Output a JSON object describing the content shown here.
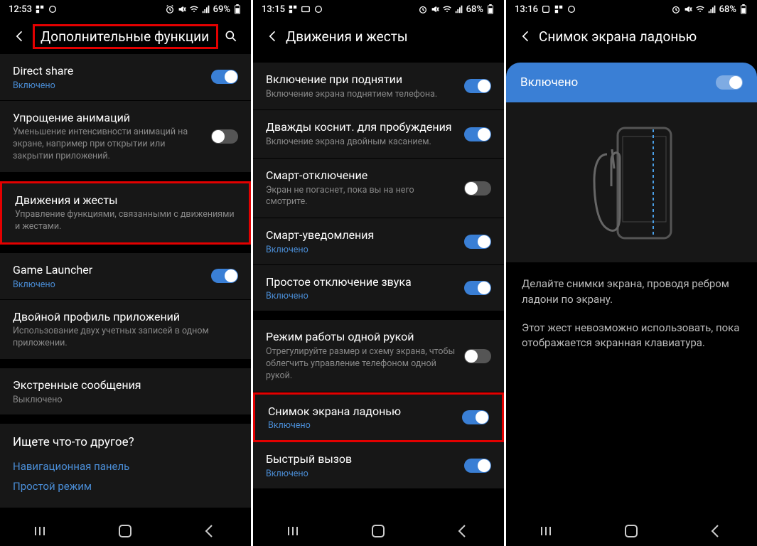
{
  "screens": [
    {
      "statusbar": {
        "time": "12:53",
        "battery": "69%"
      },
      "header": {
        "title": "Дополнительные функции",
        "has_search": true,
        "title_highlight": true
      },
      "items": [
        {
          "title": "Direct share",
          "status": "Включено",
          "status_on": true,
          "toggle": true
        },
        {
          "title": "Упрощение анимаций",
          "desc": "Уменьшение интенсивности анимаций на экране, например при открытии или закрытии приложений.",
          "toggle": false
        },
        {
          "title": "Движения и жесты",
          "desc": "Управление функциями, связанными с движениями и жестами.",
          "gap_before": true,
          "highlight": true
        },
        {
          "title": "Game Launcher",
          "status": "Включено",
          "status_on": true,
          "toggle": true,
          "gap_before": true
        },
        {
          "title": "Двойной профиль приложений",
          "desc": "Использование двух учетных записей в одном приложении."
        },
        {
          "title": "Экстренные сообщения",
          "status": "Выключено",
          "status_on": false,
          "gap_before": true
        }
      ],
      "looking": {
        "title": "Ищете что-то другое?",
        "links": [
          "Навигационная панель",
          "Простой режим"
        ]
      }
    },
    {
      "statusbar": {
        "time": "13:15",
        "battery": "68%"
      },
      "header": {
        "title": "Движения и жесты",
        "has_search": false
      },
      "items": [
        {
          "title": "Включение при поднятии",
          "desc": "Включение экрана поднятием телефона.",
          "toggle": true,
          "gap_before": true
        },
        {
          "title": "Дважды коснит. для пробуждения",
          "desc": "Включение экрана двойным касанием.",
          "toggle": true
        },
        {
          "title": "Смарт-отключение",
          "desc": "Экран не погаснет, пока вы на него смотрите.",
          "toggle": false
        },
        {
          "title": "Смарт-уведомления",
          "status": "Включено",
          "status_on": true,
          "toggle": true
        },
        {
          "title": "Простое отключение звука",
          "status": "Включено",
          "status_on": true,
          "toggle": true
        },
        {
          "title": "Режим работы одной рукой",
          "desc": "Отрегулируйте размер и схему экрана, чтобы облегчить управление телефоном одной рукой.",
          "toggle": false,
          "gap_before": true
        },
        {
          "title": "Снимок экрана ладонью",
          "status": "Включено",
          "status_on": true,
          "toggle": true,
          "highlight": true
        },
        {
          "title": "Быстрый вызов",
          "status": "Включено",
          "status_on": true,
          "toggle": true
        }
      ]
    },
    {
      "statusbar": {
        "time": "13:16",
        "battery": "68%"
      },
      "header": {
        "title": "Снимок экрана ладонью",
        "has_search": false
      },
      "enabled_label": "Включено",
      "desc1": "Делайте снимки экрана, проводя ребром ладони по экрану.",
      "desc2": "Этот жест невозможно использовать, пока отображается экранная клавиатура."
    }
  ]
}
